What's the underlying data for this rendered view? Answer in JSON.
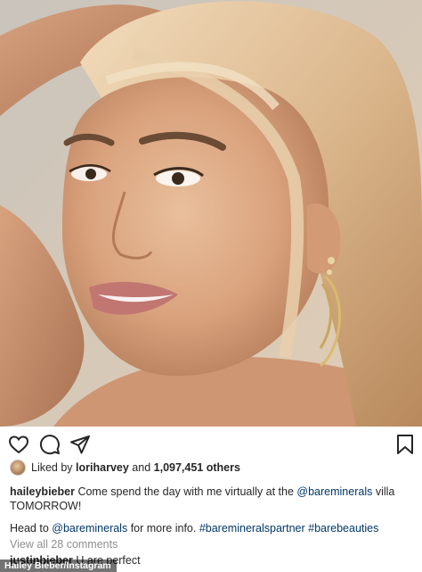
{
  "photo": {
    "alt_subject": "portrait-photo"
  },
  "actions": {
    "icons": [
      "heart-icon",
      "comment-icon",
      "share-icon",
      "bookmark-icon"
    ]
  },
  "likes": {
    "prefix": "Liked by",
    "user": "loriharvey",
    "middle": "and",
    "count": "1,097,451 others"
  },
  "caption": {
    "username": "haileybieber",
    "text_1": "Come spend the day with me virtually at the",
    "mention_1": "@bareminerals",
    "text_2": "villa TOMORROW!",
    "line2_prefix": "Head to",
    "mention_2": "@bareminerals",
    "line2_mid": "for more info.",
    "hashtag_1": "#baremineralspartner",
    "hashtag_2": "#barebeauties"
  },
  "comments": {
    "view_all": "View all 28 comments",
    "first_user": "justinbieber",
    "first_text": "U are perfect"
  },
  "credit": "Hailey Bieber/Instagram",
  "colors": {
    "link": "#00376b",
    "muted": "#8e8e8e",
    "text": "#262626"
  }
}
